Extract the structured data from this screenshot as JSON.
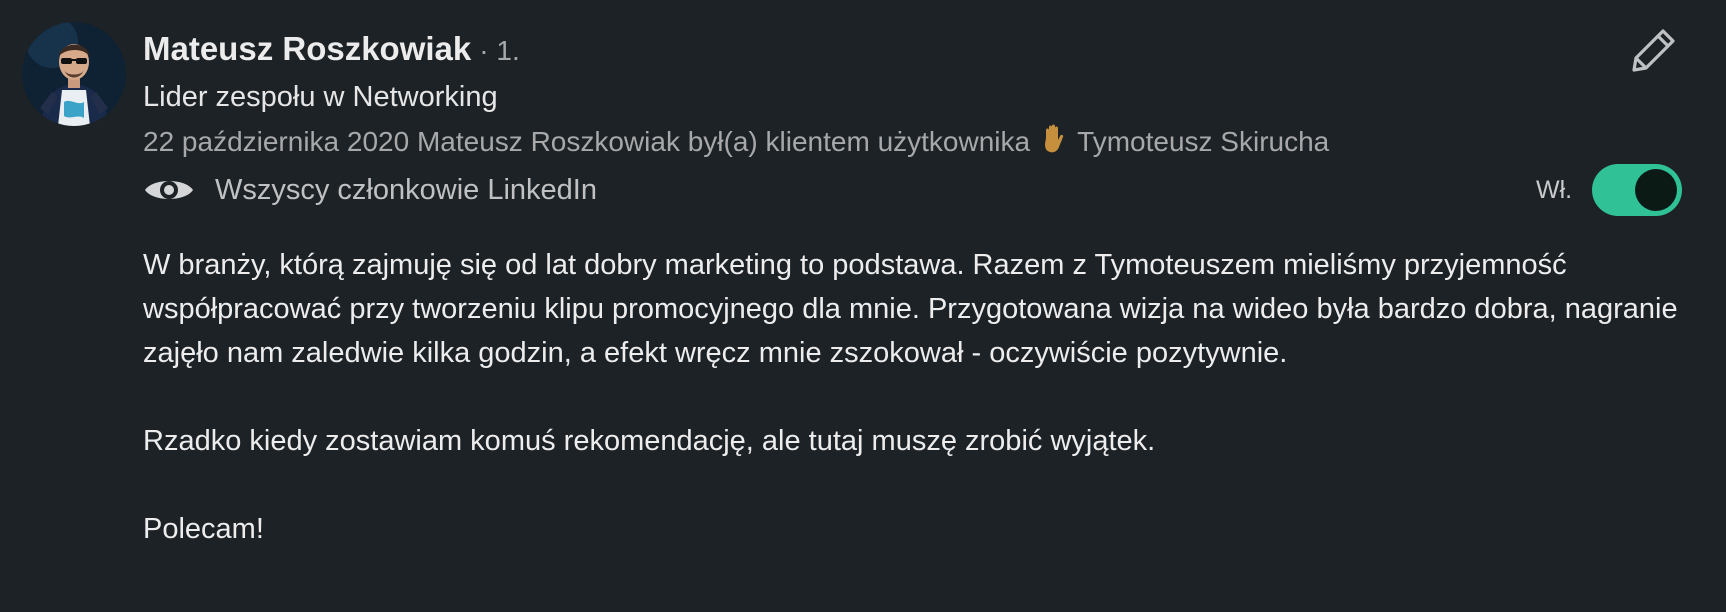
{
  "recommendation": {
    "author_name": "Mateusz Roszkowiak",
    "connection_degree": "· 1.",
    "headline": "Lider zespołu w Networking",
    "meta_date_relation": "22 października 2020 Mateusz Roszkowiak był(a) klientem użytkownika",
    "meta_recipient": "Tymoteusz Skirucha",
    "visibility_label": "Wszyscy członkowie LinkedIn",
    "toggle_label": "Wł.",
    "toggle_state": "on",
    "paragraphs": [
      "W branży, którą zajmuję się od lat dobry marketing to podstawa. Razem z Tymoteuszem mieliśmy przyjemność współpracować przy tworzeniu klipu promocyjnego dla mnie. Przygotowana wizja na wideo była bardzo dobra, nagranie zajęło nam zaledwie kilka godzin, a efekt wręcz mnie zszokował - oczywiście pozytywnie.",
      "Rzadko kiedy zostawiam komuś rekomendację, ale tutaj muszę zrobić wyjątek.",
      "Polecam!"
    ]
  },
  "icons": {
    "edit": "pencil-icon",
    "visibility": "eye-icon",
    "hand": "raised-hand-icon"
  },
  "colors": {
    "background": "#1d2226",
    "toggle_on": "#30c196",
    "muted_text": "#a6a8aa"
  }
}
